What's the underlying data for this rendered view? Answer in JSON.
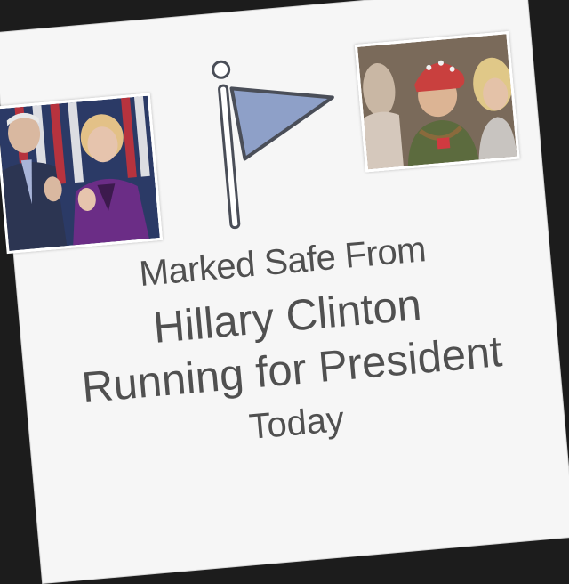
{
  "meme": {
    "line_1": "Marked Safe From",
    "line_2": "Hillary Clinton",
    "line_3": "Running for President",
    "line_4": "Today"
  },
  "icons": {
    "flag": "safety-flag-icon"
  },
  "colors": {
    "text": "#505050",
    "flag_fill": "#8ea0c8",
    "flag_outline": "#4a4e58",
    "card": "#f6f6f6",
    "background": "#1c1c1c"
  }
}
